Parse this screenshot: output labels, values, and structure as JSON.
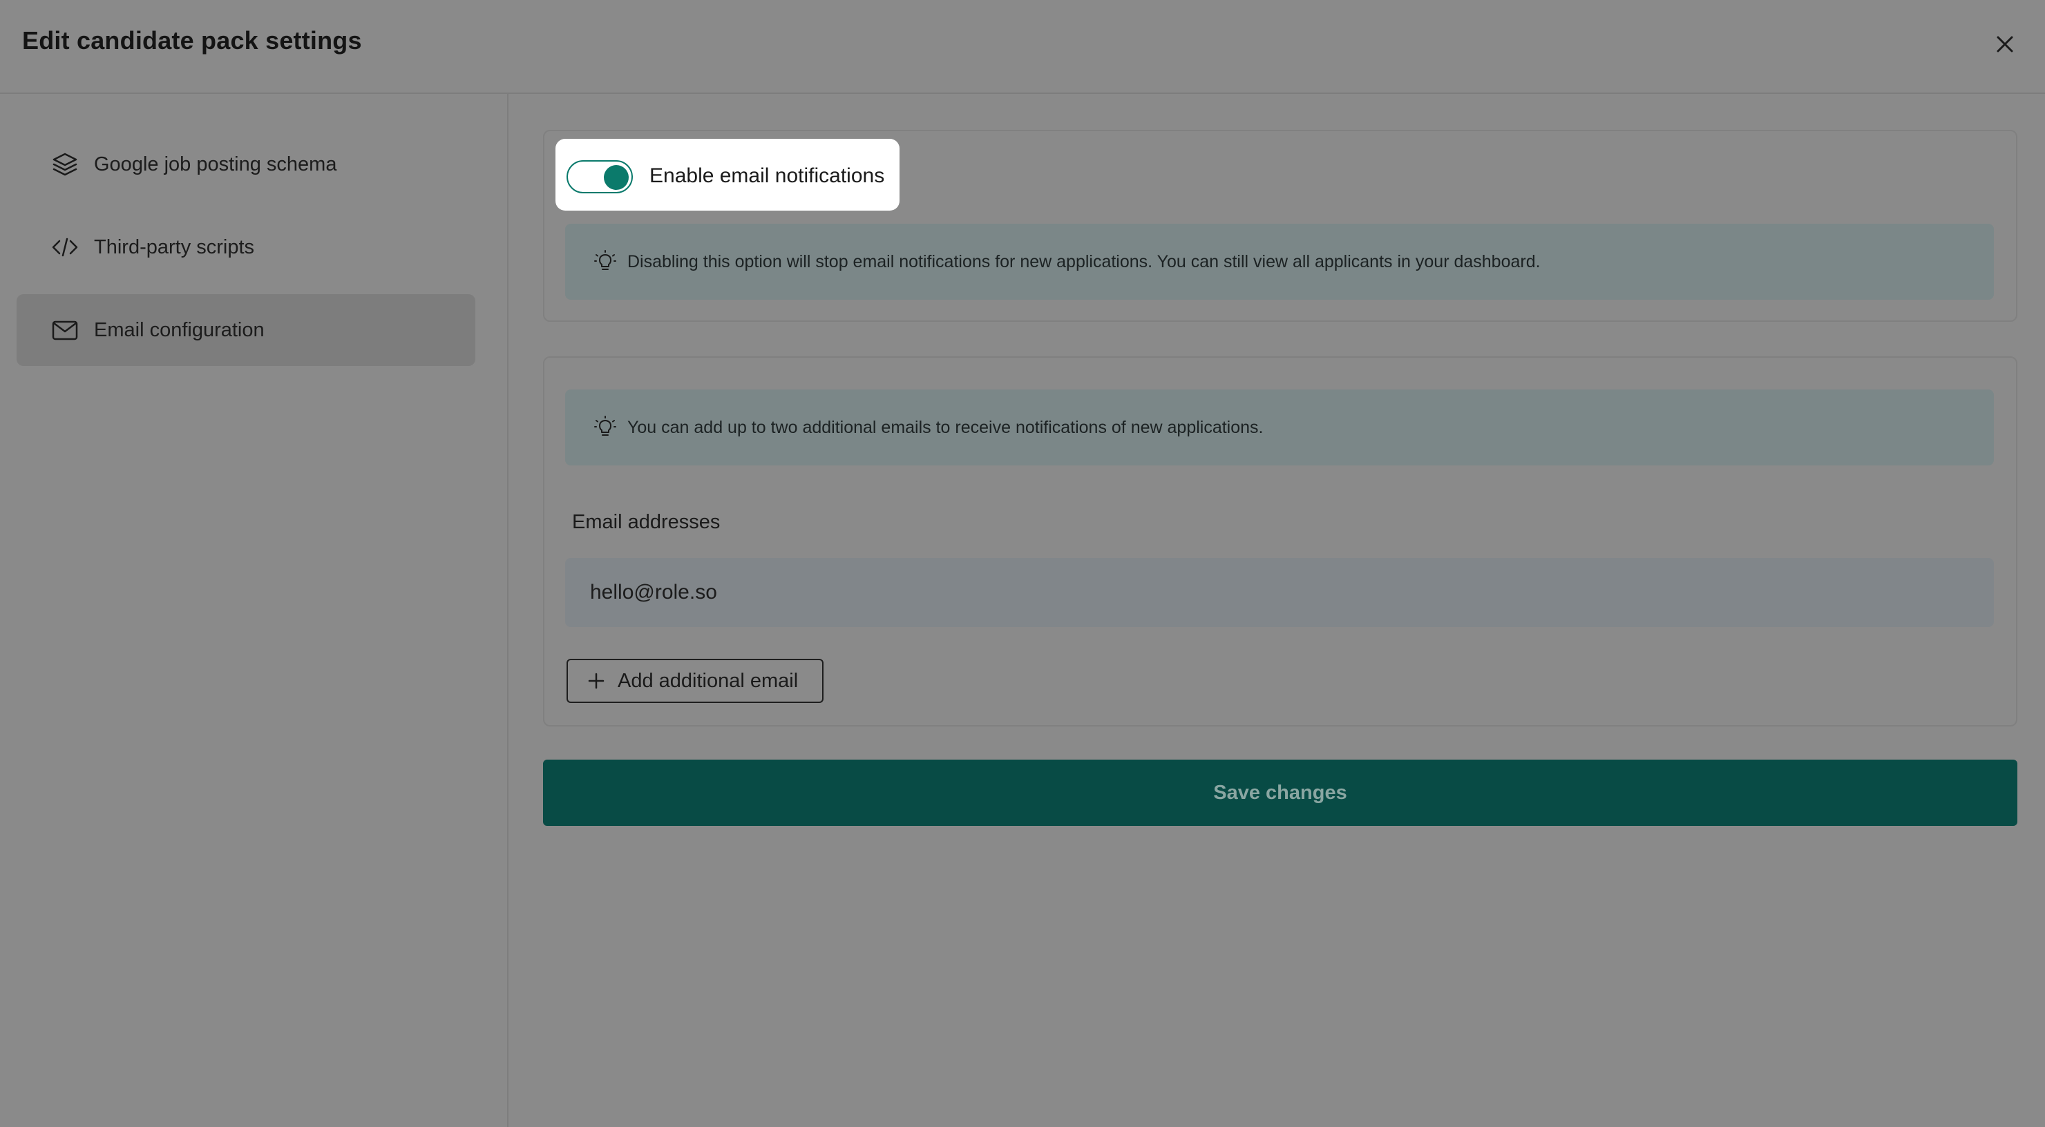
{
  "modal": {
    "title": "Edit candidate pack settings",
    "close_icon": "close-icon"
  },
  "sidebar": {
    "items": [
      {
        "label": "Google job posting schema",
        "icon": "layers-icon",
        "active": false
      },
      {
        "label": "Third-party scripts",
        "icon": "code-icon",
        "active": false
      },
      {
        "label": "Email configuration",
        "icon": "mail-icon",
        "active": true
      }
    ]
  },
  "notifications": {
    "toggle_label": "Enable email notifications",
    "enabled": true,
    "info_text": "Disabling this option will stop email notifications for new applications. You can still view all applicants in your dashboard."
  },
  "emails": {
    "info_text": "You can add up to two additional emails to receive notifications of new applications.",
    "field_label": "Email addresses",
    "value": "hello@role.so",
    "add_button_label": "Add additional email"
  },
  "actions": {
    "save_label": "Save changes"
  },
  "colors": {
    "accent": "#0b7a6b",
    "save_button": "#084b45"
  }
}
